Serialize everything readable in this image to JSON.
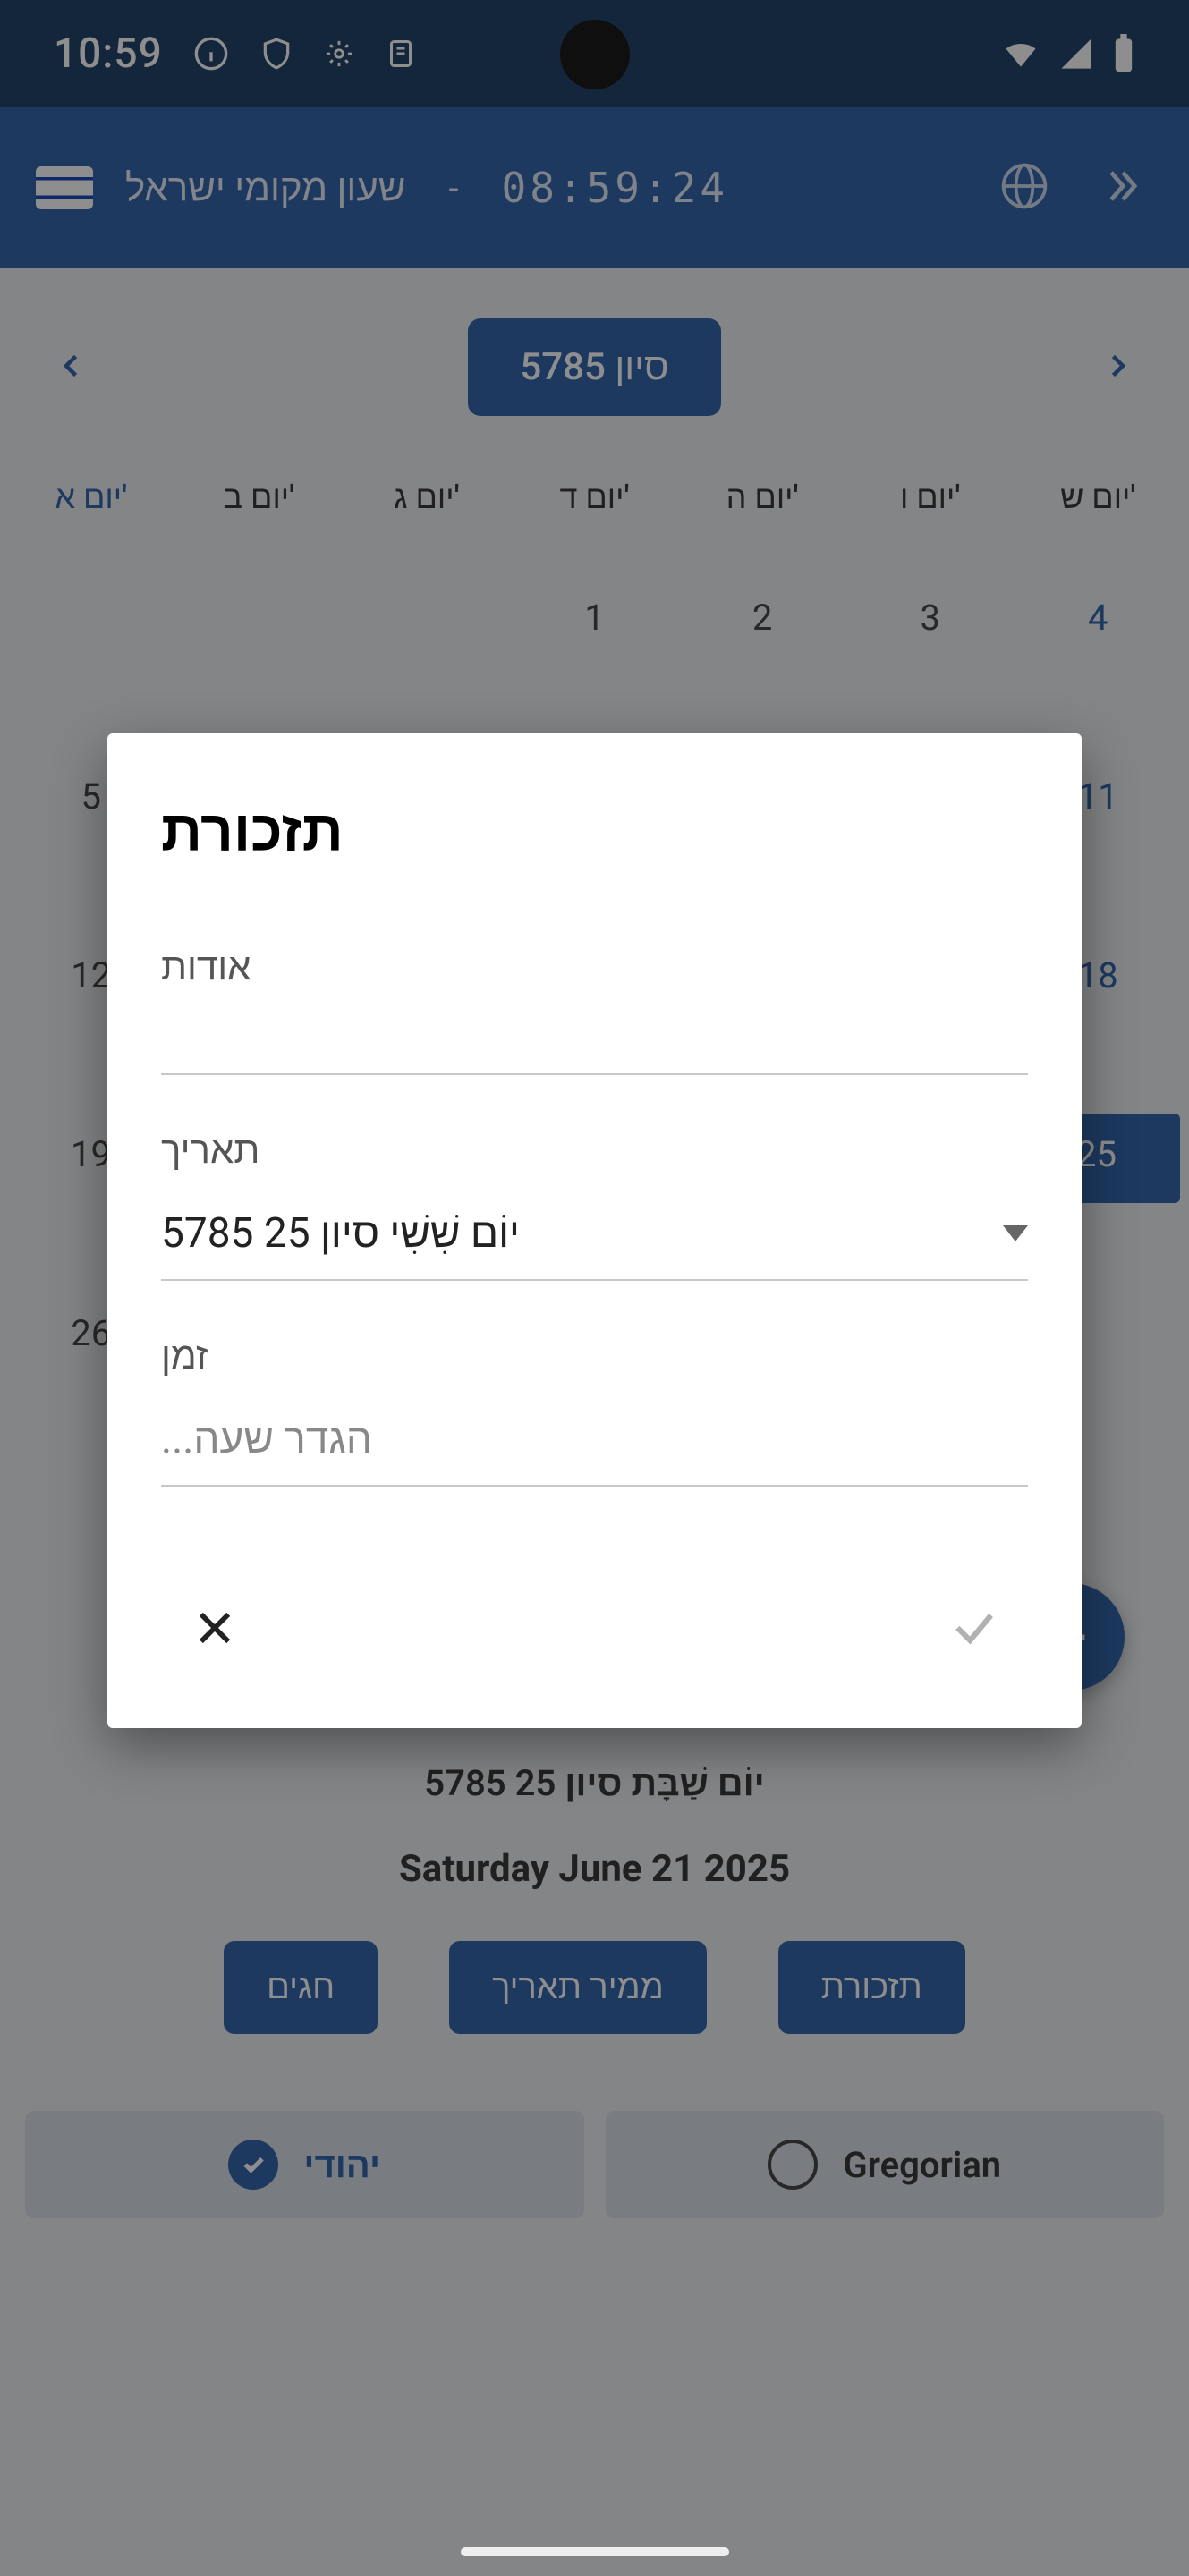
{
  "statusbar": {
    "time": "10:59"
  },
  "appbar": {
    "location": "שעון מקומי ישראל",
    "separator": "-",
    "clock": "08:59:24"
  },
  "monthnav": {
    "label": "סיון 5785"
  },
  "day_headers": [
    "יום א'",
    "יום ב'",
    "יום ג'",
    "יום ד'",
    "יום ה'",
    "יום ו'",
    "יום ש'"
  ],
  "calendar": {
    "rows": [
      [
        "",
        "",
        "",
        "1",
        "2",
        "3",
        "4"
      ],
      [
        "5",
        "",
        "",
        "",
        "",
        "",
        "11"
      ],
      [
        "12",
        "",
        "",
        "",
        "",
        "",
        "18"
      ],
      [
        "19",
        "",
        "",
        "",
        "",
        "",
        "25"
      ],
      [
        "26",
        "",
        "",
        "",
        "",
        "",
        ""
      ]
    ],
    "selected": "25"
  },
  "summary": {
    "hebrew": "יוֹם שַׁבָּת סיון 25 5785",
    "gregorian": "Saturday June 21 2025"
  },
  "actions": {
    "holidays": "חגים",
    "converter": "ממיר תאריך",
    "reminder": "תזכורת"
  },
  "segmented": {
    "hebrew": "יהודי",
    "gregorian": "Gregorian"
  },
  "modal": {
    "title": "תזכורת",
    "about_label": "אודות",
    "about_value": "",
    "date_label": "תאריך",
    "date_value": "יוֹם שִׁשִׁי סיון 25 5785",
    "time_label": "זמן",
    "time_placeholder": "הגדר שעה..."
  }
}
